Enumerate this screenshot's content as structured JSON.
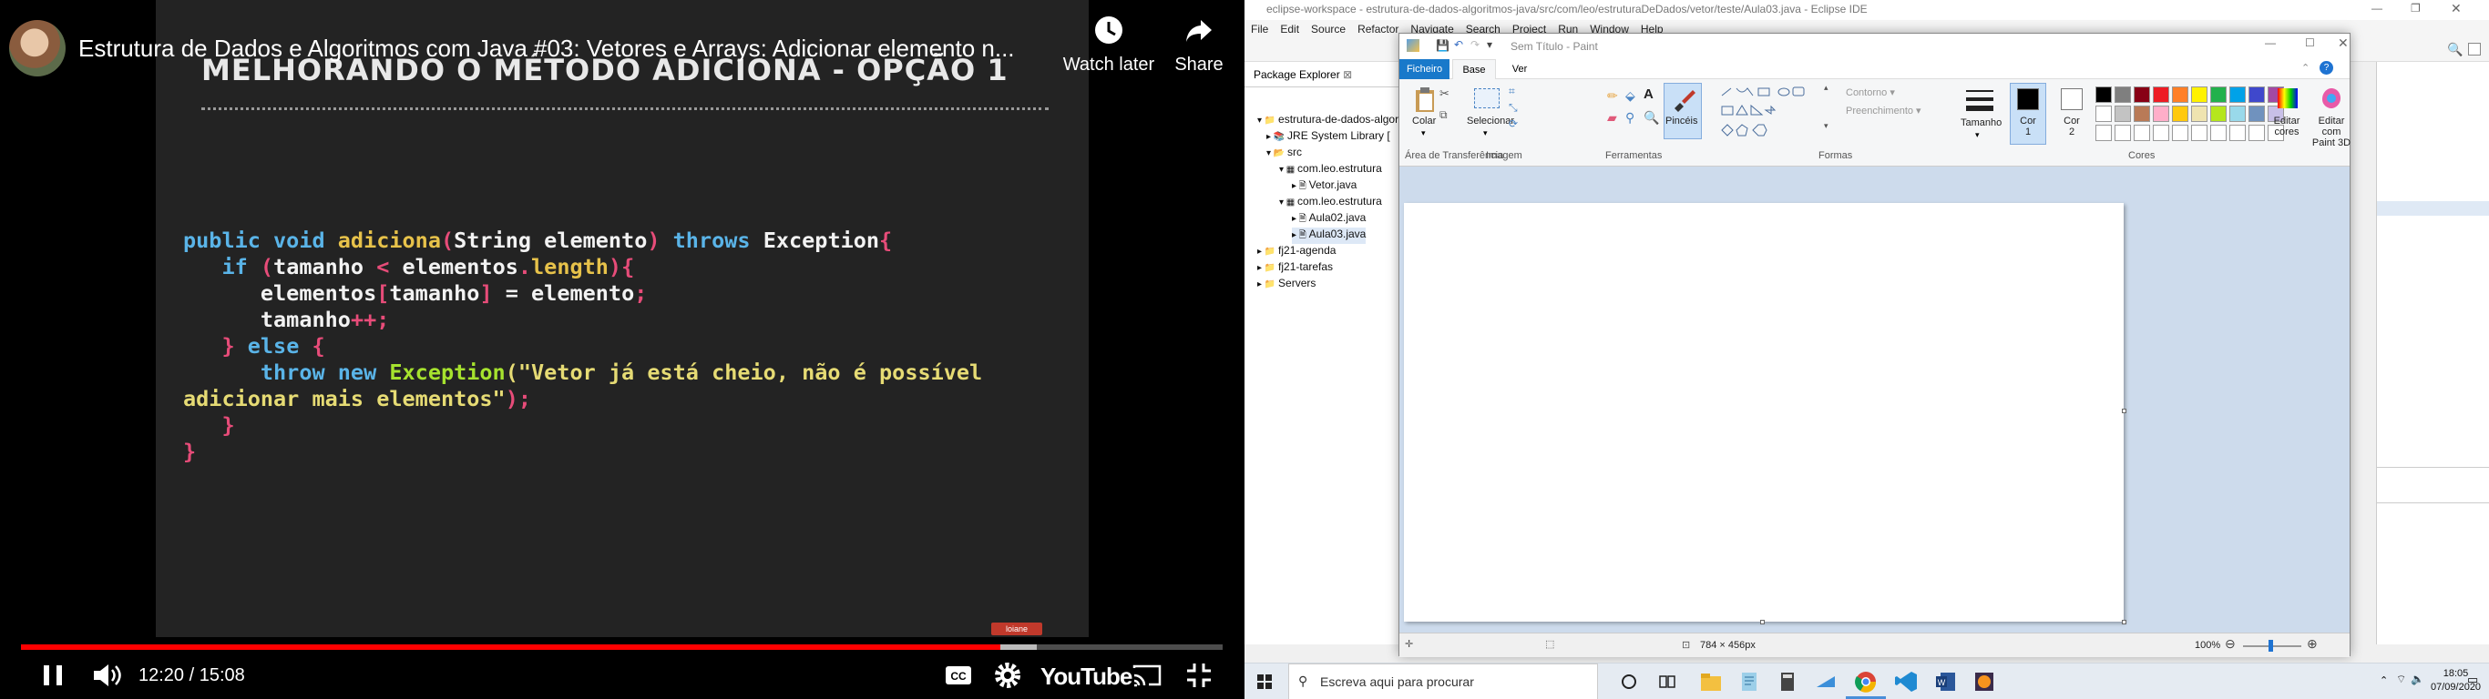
{
  "youtube": {
    "video_title": "Estrutura de Dados e Algoritmos com Java #03: Vetores e Arrays: Adicionar elemento n...",
    "watch_later": "Watch later",
    "share": "Share",
    "time": "12:20 / 15:08",
    "logo": "YouTube",
    "progress": 0.815,
    "slide": {
      "title": "MELHORANDO O MÉTODO ADICIONA - OPÇÃO 1",
      "code_lines": [
        [
          "public void ",
          "adiciona",
          "(",
          "String elemento",
          ") ",
          "throws ",
          "Exception",
          "{"
        ],
        [
          "   if ",
          "(",
          "tamanho ",
          "< ",
          "elementos",
          ".",
          "length",
          "){"
        ],
        [
          "      elementos",
          "[",
          "tamanho",
          "] ",
          "= ",
          "elemento",
          ";"
        ],
        [
          "      tamanho",
          "++;"
        ],
        [
          "   } ",
          "else ",
          "{"
        ],
        [
          "      throw new ",
          "Exception",
          "(\"Vetor já está cheio, não é possível"
        ],
        [
          "adicionar mais elementos\"",
          ");"
        ],
        [
          "   }"
        ],
        [
          "}"
        ]
      ],
      "badge": "loiane"
    }
  },
  "eclipse": {
    "title": "eclipse-workspace - estrutura-de-dados-algoritmos-java/src/com/leo/estruturaDeDados/vetor/teste/Aula03.java - Eclipse IDE",
    "menu": [
      "File",
      "Edit",
      "Source",
      "Refactor",
      "Navigate",
      "Search",
      "Project",
      "Run",
      "Window",
      "Help"
    ],
    "package_explorer_tab": "Package Explorer",
    "tree": [
      "estrutura-de-dados-algori",
      "JRE System Library [",
      "src",
      "com.leo.estrutura",
      "Vetor.java",
      "com.leo.estrutura",
      "Aula02.java",
      "Aula03.java",
      "fj21-agenda",
      "fj21-tarefas",
      "Servers"
    ]
  },
  "paint": {
    "title": "Sem Título - Paint",
    "tabs": [
      "Ficheiro",
      "Base",
      "Ver"
    ],
    "buttons": {
      "colar": "Colar",
      "selecionar": "Selecionar",
      "pinceis": "Pincéis",
      "contorno": "Contorno",
      "preenchimento": "Preenchimento",
      "tamanho": "Tamanho",
      "cor1": "Cor 1",
      "cor2": "Cor 2",
      "editar_cores": "Editar cores",
      "editar_3d": "Editar com Paint 3D"
    },
    "groups": [
      "Área de Transferência",
      "Imagem",
      "Ferramentas",
      "Formas",
      "Cores"
    ],
    "palette": [
      "#000000",
      "#7f7f7f",
      "#880015",
      "#ed1c24",
      "#ff7f27",
      "#fff200",
      "#22b14c",
      "#00a2e8",
      "#3f48cc",
      "#a349a4",
      "#ffffff",
      "#c3c3c3",
      "#b97a57",
      "#ffaec9",
      "#ffc90e",
      "#efe4b0",
      "#b5e61d",
      "#99d9ea",
      "#7092be",
      "#c8bfe7"
    ],
    "canvas_size": "784 × 456px",
    "zoom": "100%"
  },
  "taskbar": {
    "search_placeholder": "Escreva aqui para procurar",
    "time": "18:05",
    "date": "07/09/2020"
  }
}
